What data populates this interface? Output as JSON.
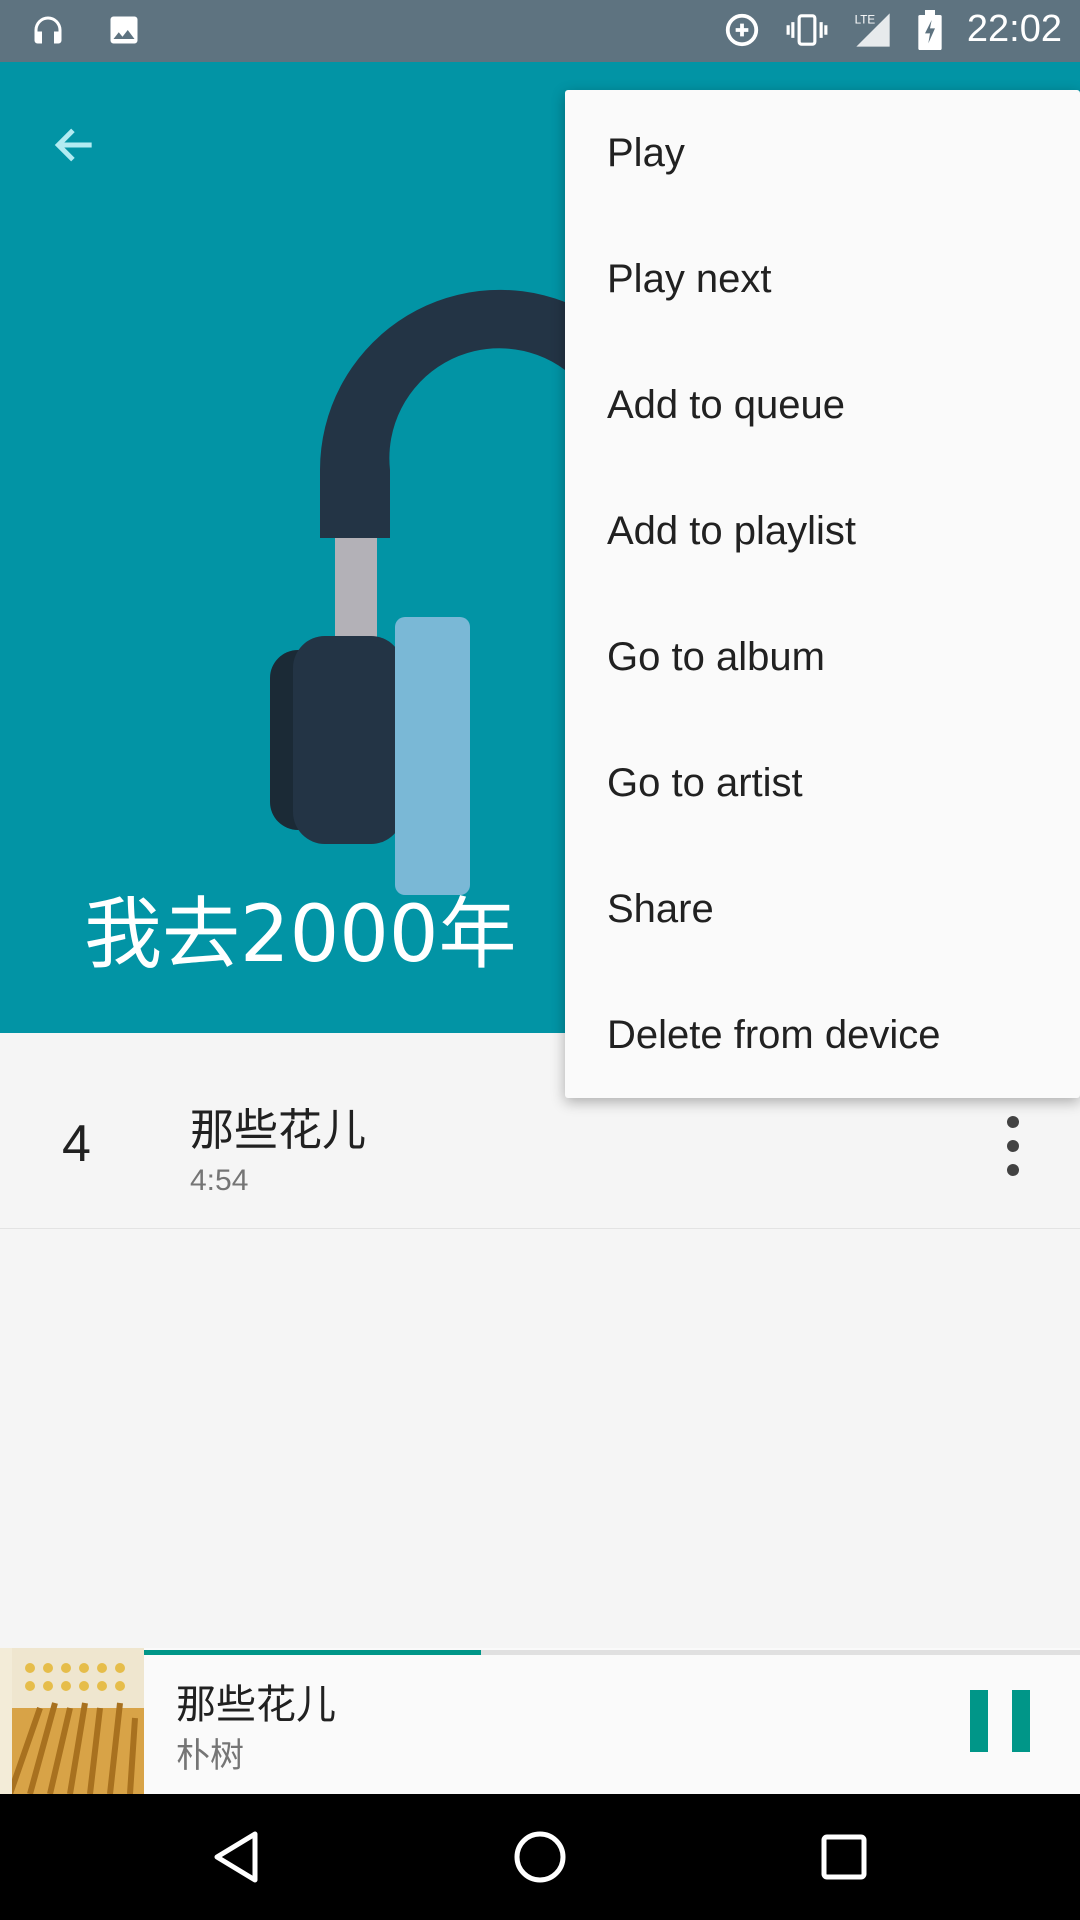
{
  "status_bar": {
    "time": "22:02"
  },
  "header": {
    "album_title": "我去2000年",
    "background_color": "#0294a5"
  },
  "track_list": [
    {
      "number": "4",
      "title": "那些花儿",
      "duration": "4:54"
    }
  ],
  "context_menu": {
    "items": [
      {
        "label": "Play"
      },
      {
        "label": "Play next"
      },
      {
        "label": "Add to queue"
      },
      {
        "label": "Add to playlist"
      },
      {
        "label": "Go to album"
      },
      {
        "label": "Go to artist"
      },
      {
        "label": "Share"
      },
      {
        "label": "Delete from device"
      }
    ]
  },
  "mini_player": {
    "title": "那些花儿",
    "artist": "朴树",
    "progress": 0.36,
    "accent_color": "#009688"
  }
}
